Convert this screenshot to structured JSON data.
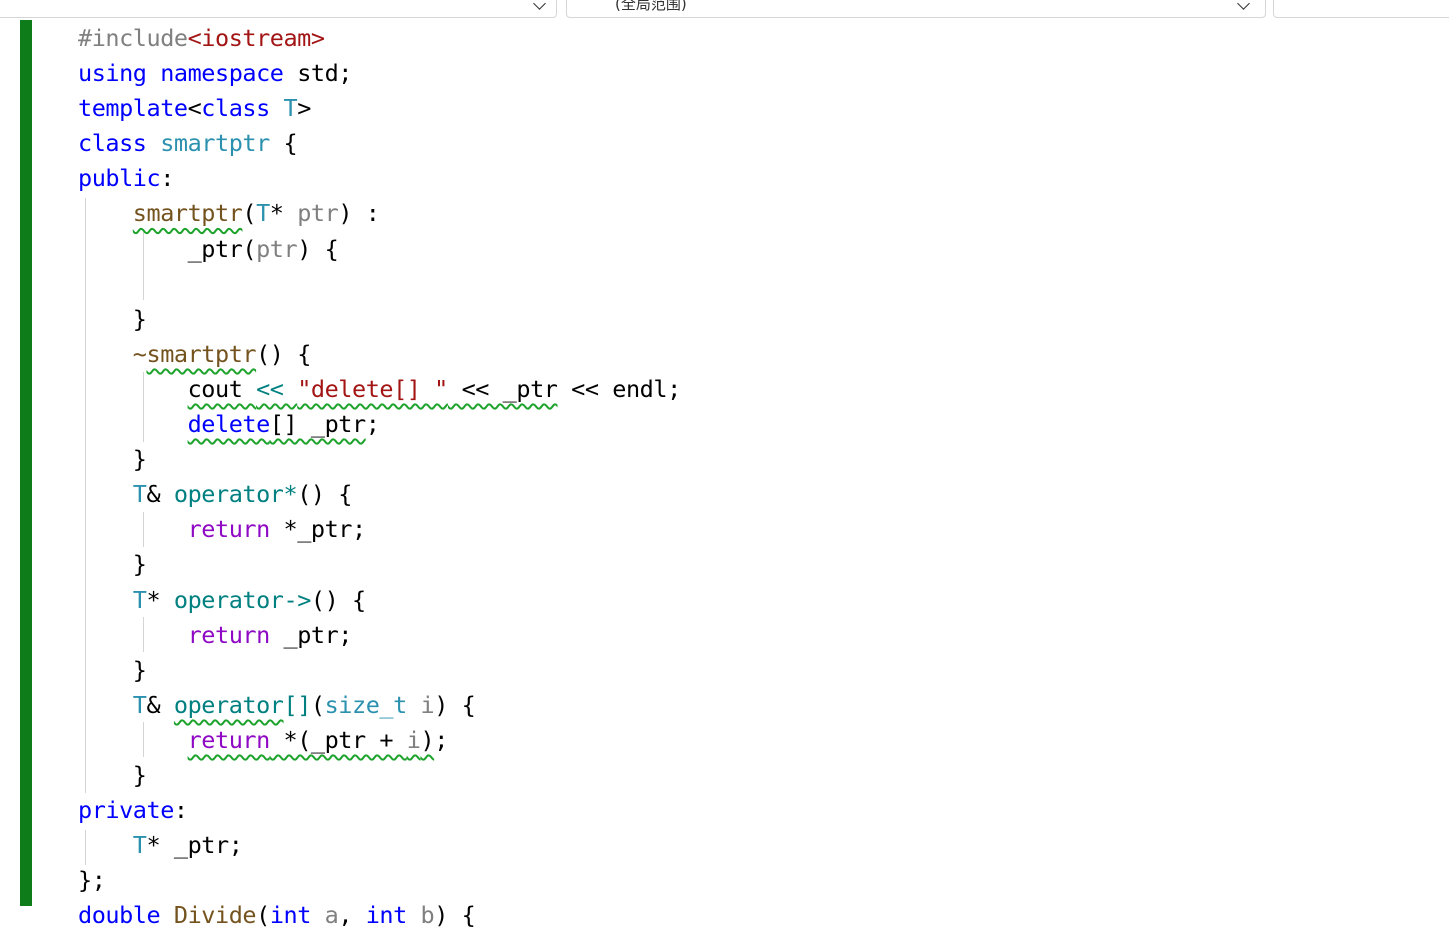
{
  "topbar": {
    "scope_dropdown": {
      "value": "(全局范围)"
    }
  },
  "editor": {
    "colors": {
      "keyword": "#0000ff",
      "keyword_control": "#8f08c4",
      "type": "#2b91af",
      "function": "#74531f",
      "string": "#a31515",
      "preprocessor": "#808080",
      "change_bar": "#0e7d19",
      "squiggle": "#1da32c"
    },
    "lines": [
      [
        {
          "t": "#include",
          "c": "pre"
        },
        {
          "t": "<iostream>",
          "c": "str"
        }
      ],
      [
        {
          "t": "using",
          "c": "kw"
        },
        {
          "t": " ",
          "c": "plain"
        },
        {
          "t": "namespace",
          "c": "kw"
        },
        {
          "t": " std;",
          "c": "plain"
        }
      ],
      [
        {
          "t": "template",
          "c": "kw"
        },
        {
          "t": "<",
          "c": "plain"
        },
        {
          "t": "class",
          "c": "kw"
        },
        {
          "t": " ",
          "c": "plain"
        },
        {
          "t": "T",
          "c": "type"
        },
        {
          "t": ">",
          "c": "plain"
        }
      ],
      [
        {
          "t": "class",
          "c": "kw"
        },
        {
          "t": " ",
          "c": "plain"
        },
        {
          "t": "smartptr",
          "c": "type"
        },
        {
          "t": " {",
          "c": "plain"
        }
      ],
      [
        {
          "t": "public",
          "c": "kw"
        },
        {
          "t": ":",
          "c": "plain"
        }
      ],
      [
        {
          "t": "    ",
          "c": "plain"
        },
        {
          "t": "smartptr",
          "c": "fn",
          "sq": true
        },
        {
          "t": "(",
          "c": "plain"
        },
        {
          "t": "T",
          "c": "type"
        },
        {
          "t": "* ",
          "c": "plain"
        },
        {
          "t": "ptr",
          "c": "param"
        },
        {
          "t": ") :",
          "c": "plain"
        }
      ],
      [
        {
          "t": "        _ptr(",
          "c": "plain"
        },
        {
          "t": "ptr",
          "c": "param"
        },
        {
          "t": ") {",
          "c": "plain"
        }
      ],
      [
        {
          "t": "",
          "c": "plain"
        }
      ],
      [
        {
          "t": "    }",
          "c": "plain"
        }
      ],
      [
        {
          "t": "    ~",
          "c": "fn"
        },
        {
          "t": "smartptr",
          "c": "fn",
          "sq": true
        },
        {
          "t": "() {",
          "c": "plain"
        }
      ],
      [
        {
          "t": "        ",
          "c": "plain"
        },
        {
          "t": "cout ",
          "c": "plain",
          "sq": true
        },
        {
          "t": "<< ",
          "c": "op",
          "sq": true
        },
        {
          "t": "\"delete[] \"",
          "c": "str",
          "sq": true
        },
        {
          "t": " << _ptr",
          "c": "plain",
          "sq": true
        },
        {
          "t": " << endl;",
          "c": "plain"
        }
      ],
      [
        {
          "t": "        ",
          "c": "plain"
        },
        {
          "t": "delete",
          "c": "kw",
          "sq": true
        },
        {
          "t": "[] _ptr",
          "c": "plain",
          "sq": true
        },
        {
          "t": ";",
          "c": "plain"
        }
      ],
      [
        {
          "t": "    }",
          "c": "plain"
        }
      ],
      [
        {
          "t": "    ",
          "c": "plain"
        },
        {
          "t": "T",
          "c": "type"
        },
        {
          "t": "& ",
          "c": "plain"
        },
        {
          "t": "operator*",
          "c": "op"
        },
        {
          "t": "() {",
          "c": "plain"
        }
      ],
      [
        {
          "t": "        ",
          "c": "plain"
        },
        {
          "t": "return",
          "c": "kwp"
        },
        {
          "t": " *_ptr;",
          "c": "plain"
        }
      ],
      [
        {
          "t": "    }",
          "c": "plain"
        }
      ],
      [
        {
          "t": "    ",
          "c": "plain"
        },
        {
          "t": "T",
          "c": "type"
        },
        {
          "t": "* ",
          "c": "plain"
        },
        {
          "t": "operator->",
          "c": "op"
        },
        {
          "t": "() {",
          "c": "plain"
        }
      ],
      [
        {
          "t": "        ",
          "c": "plain"
        },
        {
          "t": "return",
          "c": "kwp"
        },
        {
          "t": " _ptr;",
          "c": "plain"
        }
      ],
      [
        {
          "t": "    }",
          "c": "plain"
        }
      ],
      [
        {
          "t": "    ",
          "c": "plain"
        },
        {
          "t": "T",
          "c": "type"
        },
        {
          "t": "& ",
          "c": "plain"
        },
        {
          "t": "operator",
          "c": "op",
          "sq": true
        },
        {
          "t": "[]",
          "c": "op"
        },
        {
          "t": "(",
          "c": "plain"
        },
        {
          "t": "size_t",
          "c": "type"
        },
        {
          "t": " ",
          "c": "plain"
        },
        {
          "t": "i",
          "c": "param"
        },
        {
          "t": ") {",
          "c": "plain"
        }
      ],
      [
        {
          "t": "        ",
          "c": "plain"
        },
        {
          "t": "return",
          "c": "kwp",
          "sq": true
        },
        {
          "t": " *(_ptr + ",
          "c": "plain",
          "sq": true
        },
        {
          "t": "i",
          "c": "param",
          "sq": true
        },
        {
          "t": ")",
          "c": "plain",
          "sq": true
        },
        {
          "t": ";",
          "c": "plain"
        }
      ],
      [
        {
          "t": "    }",
          "c": "plain"
        }
      ],
      [
        {
          "t": "private",
          "c": "kw"
        },
        {
          "t": ":",
          "c": "plain"
        }
      ],
      [
        {
          "t": "    ",
          "c": "plain"
        },
        {
          "t": "T",
          "c": "type"
        },
        {
          "t": "* _ptr;",
          "c": "plain"
        }
      ],
      [
        {
          "t": "};",
          "c": "plain"
        }
      ],
      [
        {
          "t": "double",
          "c": "kw"
        },
        {
          "t": " ",
          "c": "plain"
        },
        {
          "t": "Divide",
          "c": "fn"
        },
        {
          "t": "(",
          "c": "plain"
        },
        {
          "t": "int",
          "c": "kw"
        },
        {
          "t": " ",
          "c": "plain"
        },
        {
          "t": "a",
          "c": "param"
        },
        {
          "t": ", ",
          "c": "plain"
        },
        {
          "t": "int",
          "c": "kw"
        },
        {
          "t": " ",
          "c": "plain"
        },
        {
          "t": "b",
          "c": "param"
        },
        {
          "t": ") {",
          "c": "plain"
        }
      ]
    ]
  }
}
